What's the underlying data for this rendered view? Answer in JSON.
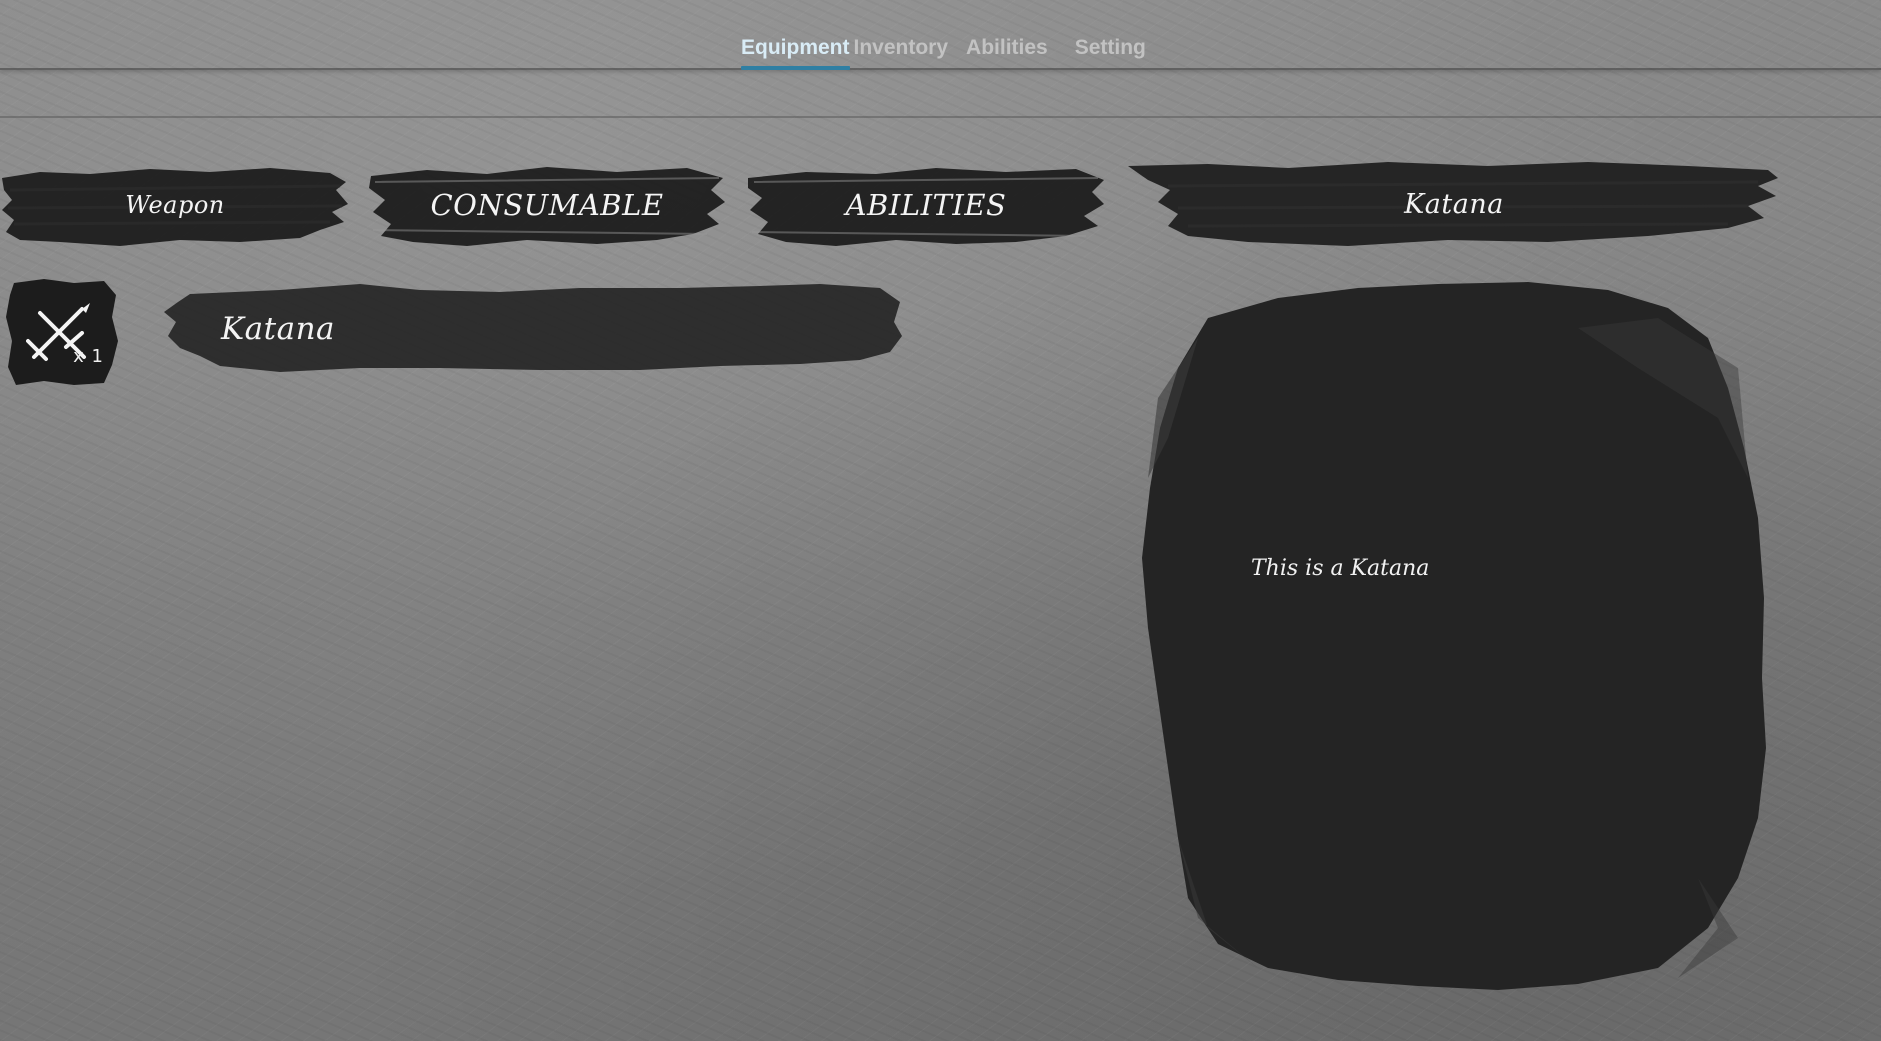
{
  "tabs": [
    {
      "label": "Equipment",
      "active": true
    },
    {
      "label": "Inventory",
      "active": false
    },
    {
      "label": "Abilities",
      "active": false
    },
    {
      "label": "Setting",
      "active": false
    }
  ],
  "categories": {
    "weapon": "Weapon",
    "consumable": "CONSUMABLE",
    "abilities": "ABILITIES"
  },
  "item_list": [
    {
      "name": "Katana",
      "icon": "crossed-swords-icon",
      "quantity": "x 1"
    }
  ],
  "detail": {
    "title": "Katana",
    "description": "This is a Katana"
  },
  "colors": {
    "background": "#838383",
    "brush": "#1f1f1f",
    "tab_active": "#d9ecf6",
    "tab_inactive": "#c2c2c2",
    "tab_underline": "#2f7fa3",
    "text": "#f4f4f4"
  }
}
